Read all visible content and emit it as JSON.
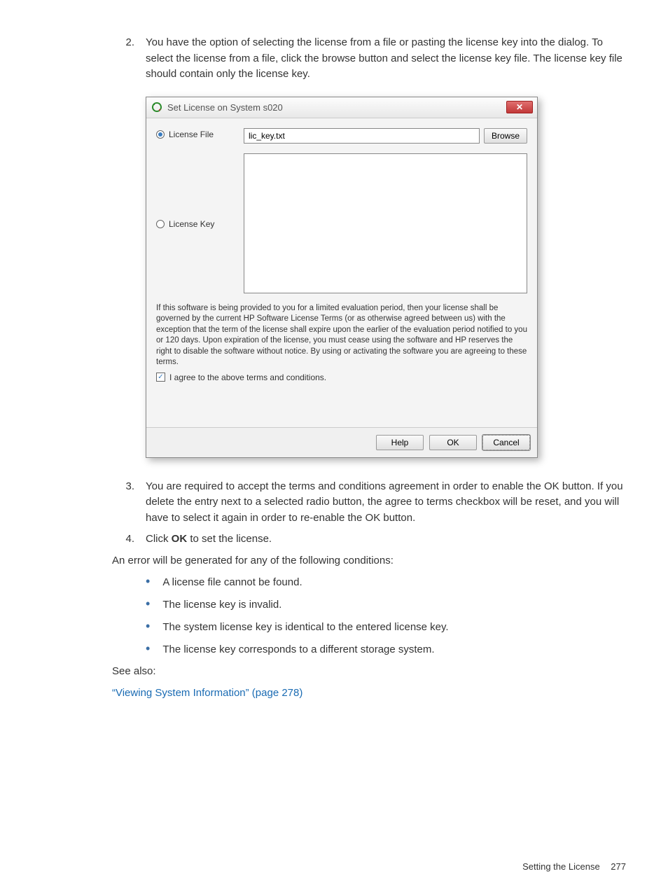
{
  "steps": {
    "s2": {
      "num": "2.",
      "text": "You have the option of selecting the license from a file or pasting the license key into the dialog. To select the license from a file, click the browse button and select the license key file. The license key file should contain only the license key."
    },
    "s3": {
      "num": "3.",
      "text": "You are required to accept the terms and conditions agreement in order to enable the OK button. If you delete the entry next to a selected radio button, the agree to terms checkbox will be reset, and you will have to select it again in order to re-enable the OK button."
    },
    "s4": {
      "num": "4.",
      "text_before": "Click ",
      "bold": "OK",
      "text_after": " to set the license."
    }
  },
  "dialog": {
    "title": "Set License on System s020",
    "license_file_label": "License File",
    "license_file_value": "lic_key.txt",
    "browse_label": "Browse",
    "license_key_label": "License Key",
    "terms": "If this software is being provided to you for a limited evaluation period, then your license shall be governed by the current HP Software License Terms (or as otherwise agreed between us) with the exception that the term of the license shall expire upon the earlier of the evaluation period notified to you or 120 days. Upon expiration of the license, you must cease using the software and HP reserves the right to disable the software without notice. By using or activating the software you are agreeing to these terms.",
    "agree_label": "I agree to the above terms and conditions.",
    "help_label": "Help",
    "ok_label": "OK",
    "cancel_label": "Cancel",
    "close_x": "✕",
    "check_mark": "✓"
  },
  "error_intro": "An error will be generated for any of the following conditions:",
  "bullets": {
    "b1": "A license file cannot be found.",
    "b2": "The license key is invalid.",
    "b3": "The system license key is identical to the entered license key.",
    "b4": "The license key corresponds to a different storage system."
  },
  "see_also_label": "See also:",
  "see_also_link": "“Viewing System Information” (page 278)",
  "footer": {
    "section": "Setting the License",
    "page": "277"
  }
}
